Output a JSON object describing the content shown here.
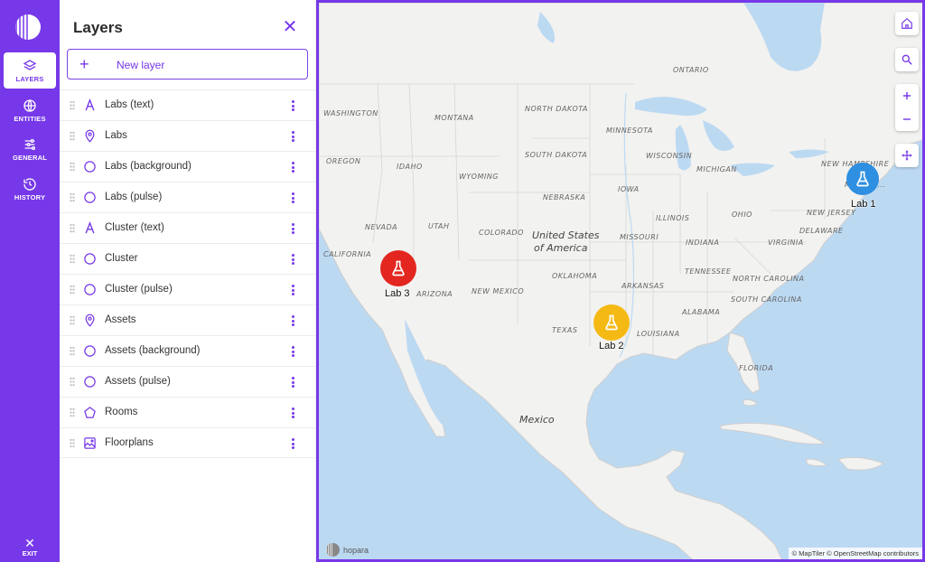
{
  "nav": {
    "items": [
      {
        "label": "LAYERS",
        "icon": "layers-icon",
        "active": true
      },
      {
        "label": "ENTITIES",
        "icon": "globe-icon",
        "active": false
      },
      {
        "label": "GENERAL",
        "icon": "sliders-icon",
        "active": false
      },
      {
        "label": "HISTORY",
        "icon": "history-icon",
        "active": false
      }
    ],
    "exit_label": "EXIT"
  },
  "panel": {
    "title": "Layers",
    "new_layer_label": "New layer",
    "layers": [
      {
        "name": "Labs (text)",
        "icon": "text-icon"
      },
      {
        "name": "Labs",
        "icon": "pin-icon"
      },
      {
        "name": "Labs (background)",
        "icon": "circle-icon"
      },
      {
        "name": "Labs (pulse)",
        "icon": "circle-icon"
      },
      {
        "name": "Cluster (text)",
        "icon": "text-icon"
      },
      {
        "name": "Cluster",
        "icon": "circle-icon"
      },
      {
        "name": "Cluster (pulse)",
        "icon": "circle-icon"
      },
      {
        "name": "Assets",
        "icon": "pin-icon"
      },
      {
        "name": "Assets (background)",
        "icon": "circle-icon"
      },
      {
        "name": "Assets (pulse)",
        "icon": "circle-icon"
      },
      {
        "name": "Rooms",
        "icon": "pentagon-icon"
      },
      {
        "name": "Floorplans",
        "icon": "image-icon"
      }
    ]
  },
  "map": {
    "labels": {
      "ontario": "ONTARIO",
      "washington": "WASHINGTON",
      "montana": "MONTANA",
      "north_dakota": "NORTH DAKOTA",
      "minnesota": "MINNESOTA",
      "south_dakota": "SOUTH DAKOTA",
      "wisconsin": "WISCONSIN",
      "michigan": "MICHIGAN",
      "oregon": "OREGON",
      "idaho": "IDAHO",
      "wyoming": "WYOMING",
      "nebraska": "NEBRASKA",
      "iowa": "IOWA",
      "new_hampshire": "NEW HAMPSHIRE",
      "massachusetts": "MASSAC...",
      "nevada": "NEVADA",
      "utah": "UTAH",
      "colorado": "COLORADO",
      "illinois": "ILLINOIS",
      "ohio": "OHIO",
      "new_jersey": "NEW JERSEY",
      "delaware": "DELAWARE",
      "missouri": "MISSOURI",
      "indiana": "INDIANA",
      "virginia": "VIRGINIA",
      "california": "CALIFORNIA",
      "kansas": "",
      "tennessee": "TENNESSEE",
      "oklahoma": "OKLAHOMA",
      "north_carolina": "NORTH CAROLINA",
      "arizona": "ARIZONA",
      "new_mexico": "NEW MEXICO",
      "arkansas": "ARKANSAS",
      "south_carolina": "SOUTH CAROLINA",
      "alabama": "ALABAMA",
      "texas": "TEXAS",
      "louisiana": "LOUISIANA",
      "florida": "FLORIDA",
      "usa_line1": "United States",
      "usa_line2": "of America",
      "mexico": "Mexico"
    },
    "pins": [
      {
        "label": "Lab 1",
        "color": "#2f8fe0"
      },
      {
        "label": "Lab 2",
        "color": "#f5b914"
      },
      {
        "label": "Lab 3",
        "color": "#e3261f"
      }
    ],
    "attribution": "© MapTiler © OpenStreetMap contributors",
    "brand": "hopara"
  }
}
